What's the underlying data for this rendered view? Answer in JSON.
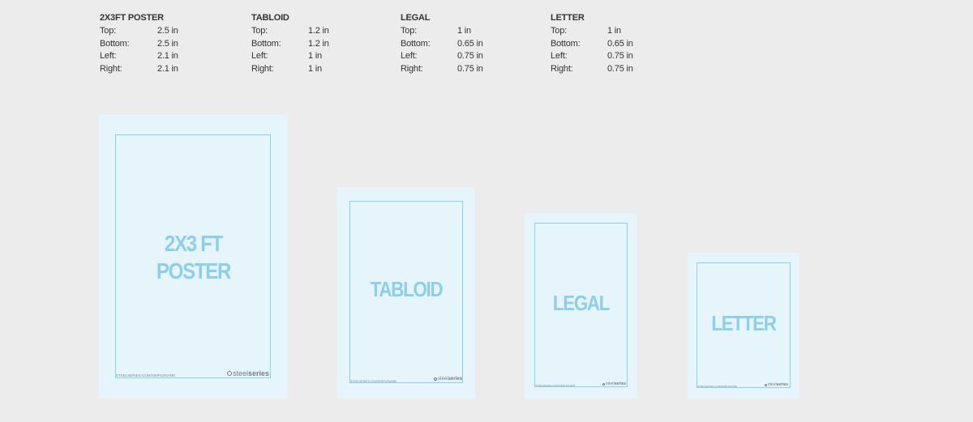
{
  "specs": [
    {
      "title": "2X3FT POSTER",
      "rows": [
        {
          "key": "Top:",
          "value": "2.5 in"
        },
        {
          "key": "Bottom:",
          "value": "2.5 in"
        },
        {
          "key": "Left:",
          "value": "2.1 in"
        },
        {
          "key": "Right:",
          "value": "2.1 in"
        }
      ]
    },
    {
      "title": "TABLOID",
      "rows": [
        {
          "key": "Top:",
          "value": "1.2 in"
        },
        {
          "key": "Bottom:",
          "value": "1.2 in"
        },
        {
          "key": "Left:",
          "value": "1 in"
        },
        {
          "key": "Right:",
          "value": "1 in"
        }
      ]
    },
    {
      "title": "LEGAL",
      "rows": [
        {
          "key": "Top:",
          "value": "1 in"
        },
        {
          "key": "Bottom:",
          "value": "0.65 in"
        },
        {
          "key": "Left:",
          "value": "0.75 in"
        },
        {
          "key": "Right:",
          "value": "0.75 in"
        }
      ]
    },
    {
      "title": "LETTER",
      "rows": [
        {
          "key": "Top:",
          "value": "1 in"
        },
        {
          "key": "Bottom:",
          "value": "0.65 in"
        },
        {
          "key": "Left:",
          "value": "0.75 in"
        },
        {
          "key": "Right:",
          "value": "0.75 in"
        }
      ]
    }
  ],
  "sheets": [
    {
      "label_line1": "2X3 FT",
      "label_line2": "POSTER",
      "footer_url": "steelseries.com/simplename",
      "brand_light": "steel",
      "brand_bold": "series"
    },
    {
      "label_line1": "TABLOID",
      "footer_url": "steelseries.com/simplename",
      "brand_light": "steel",
      "brand_bold": "series"
    },
    {
      "label_line1": "LEGAL",
      "footer_url": "steelseries.com/simplename",
      "brand_light": "steel",
      "brand_bold": "series"
    },
    {
      "label_line1": "LETTER",
      "footer_url": "steelseries.com/simplename",
      "brand_light": "steel",
      "brand_bold": "series"
    }
  ],
  "colors": {
    "background": "#ececec",
    "sheet_fill": "#e6f4fc",
    "margin_line": "#8ccfea",
    "label_text": "#8ccfea"
  }
}
